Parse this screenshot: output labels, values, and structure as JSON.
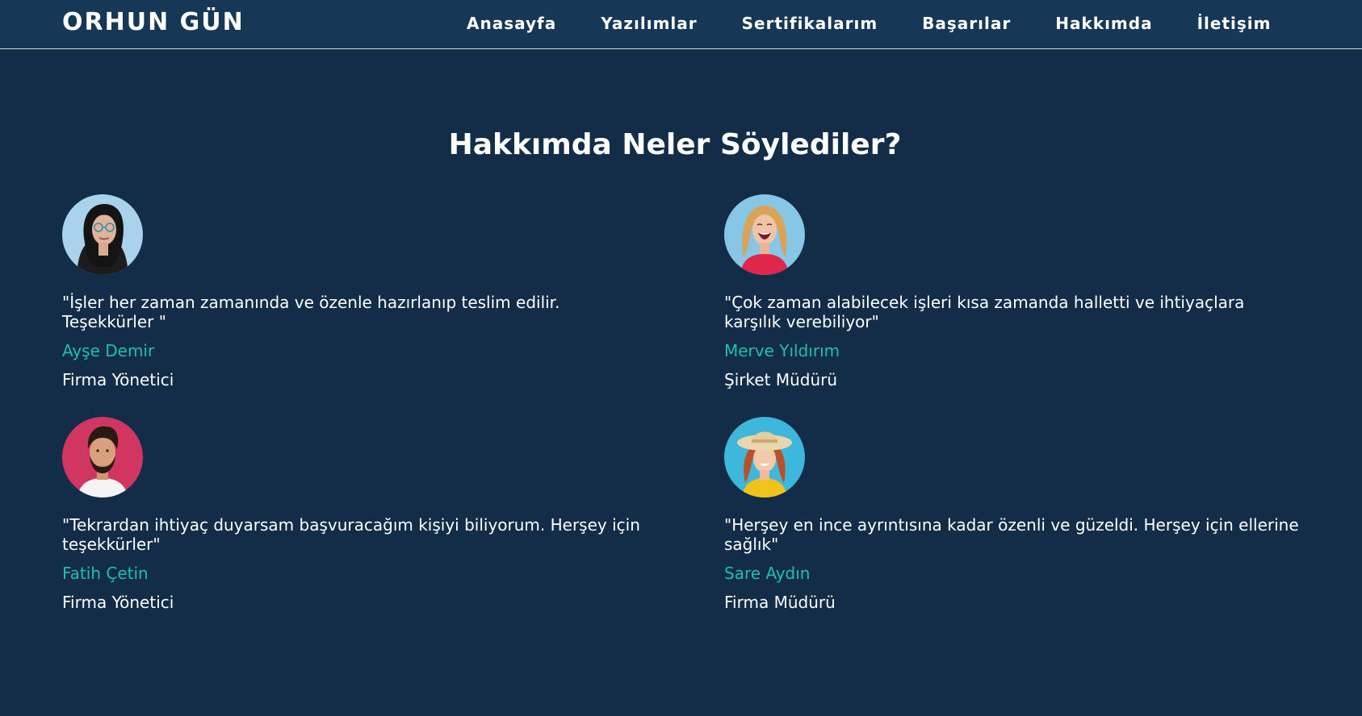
{
  "nav": {
    "brand": "ORHUN GÜN",
    "links": [
      "Anasayfa",
      "Yazılımlar",
      "Sertifikalarım",
      "Başarılar",
      "Hakkımda",
      "İletişim"
    ]
  },
  "section": {
    "title": "Hakkımda Neler Söylediler?"
  },
  "testimonials": [
    {
      "quote": "\"İşler her zaman zamanında ve özenle hazırlanıp teslim edilir. Teşekkürler \"",
      "name": "Ayşe Demir",
      "role": "Firma Yönetici",
      "avatar_bg": "#a9d3ea"
    },
    {
      "quote": "\"Çok zaman alabilecek işleri kısa zamanda halletti ve ihtiyaçlara karşılık verebiliyor\"",
      "name": "Merve Yıldırım",
      "role": "Şirket Müdürü",
      "avatar_bg": "#88c6e6"
    },
    {
      "quote": "\"Tekrardan ihtiyaç duyarsam başvuracağım kişiyi biliyorum. Herşey için teşekkürler\"",
      "name": "Fatih Çetin",
      "role": "Firma Yönetici",
      "avatar_bg": "#d0365f"
    },
    {
      "quote": "\"Herşey en ince ayrıntısına kadar özenli ve güzeldi. Herşey için ellerine sağlık\"",
      "name": "Sare Aydın",
      "role": "Firma Müdürü",
      "avatar_bg": "#3db8dc"
    }
  ],
  "colors": {
    "page_bg": "#132d48",
    "nav_bg": "#163756",
    "accent": "#1fc0a5",
    "text": "#ffffff"
  }
}
